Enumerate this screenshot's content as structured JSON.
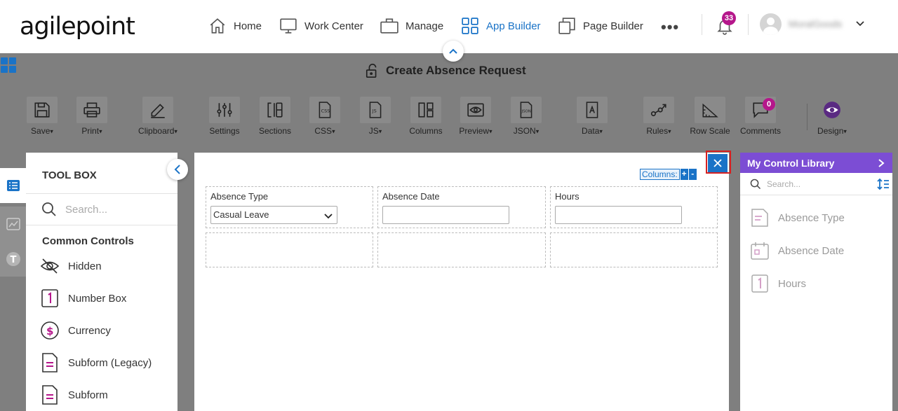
{
  "brand": {
    "logo_text": "agilepoint"
  },
  "nav": {
    "items": [
      {
        "label": "Home",
        "icon": "home-icon"
      },
      {
        "label": "Work Center",
        "icon": "monitor-icon"
      },
      {
        "label": "Manage",
        "icon": "briefcase-icon"
      },
      {
        "label": "App Builder",
        "icon": "grid-icon",
        "active": true
      },
      {
        "label": "Page Builder",
        "icon": "pages-icon"
      }
    ],
    "more": "•••",
    "notifications_count": "33",
    "user_name": "MoralGoods"
  },
  "form": {
    "title": "Create Absence Request"
  },
  "ribbon": {
    "tools": [
      {
        "label": "Save",
        "dropdown": true
      },
      {
        "label": "Print",
        "dropdown": true
      },
      {
        "label": "Clipboard",
        "dropdown": true
      },
      {
        "label": "Settings",
        "dropdown": false
      },
      {
        "label": "Sections",
        "dropdown": false
      },
      {
        "label": "CSS",
        "dropdown": true
      },
      {
        "label": "JS",
        "dropdown": true
      },
      {
        "label": "Columns",
        "dropdown": false
      },
      {
        "label": "Preview",
        "dropdown": true
      },
      {
        "label": "JSON",
        "dropdown": true
      },
      {
        "label": "Data",
        "dropdown": true
      },
      {
        "label": "Rules",
        "dropdown": true
      },
      {
        "label": "Row Scale",
        "dropdown": false
      },
      {
        "label": "Comments",
        "dropdown": false
      },
      {
        "label": "Design",
        "dropdown": true
      }
    ],
    "comments_count": "0",
    "caret": "▾"
  },
  "toolbox": {
    "title": "TOOL BOX",
    "search_placeholder": "Search...",
    "section_title": "Common Controls",
    "items": [
      {
        "label": "Hidden",
        "icon": "eye-off-icon"
      },
      {
        "label": "Number Box",
        "icon": "number-one-icon"
      },
      {
        "label": "Currency",
        "icon": "dollar-icon"
      },
      {
        "label": "Subform (Legacy)",
        "icon": "document-icon"
      },
      {
        "label": "Subform",
        "icon": "document-icon"
      }
    ]
  },
  "canvas": {
    "columns_label": "Columns:",
    "columns_add": "+",
    "columns_remove": "-",
    "fields": [
      {
        "label": "Absence Type",
        "value": "Casual Leave",
        "type": "dropdown"
      },
      {
        "label": "Absence Date",
        "value": "",
        "type": "text"
      },
      {
        "label": "Hours",
        "value": "",
        "type": "text"
      }
    ]
  },
  "library": {
    "title": "My Control Library",
    "search_placeholder": "Search...",
    "items": [
      {
        "label": "Absence Type",
        "icon": "dropdown-field-icon"
      },
      {
        "label": "Absence Date",
        "icon": "calendar-icon"
      },
      {
        "label": "Hours",
        "icon": "number-one-icon"
      }
    ]
  },
  "colors": {
    "accent": "#1a73c7",
    "library_header": "#7c4dd4",
    "badge": "#b5178b",
    "highlight": "#d62020",
    "overlay": "#7f7f7f"
  }
}
